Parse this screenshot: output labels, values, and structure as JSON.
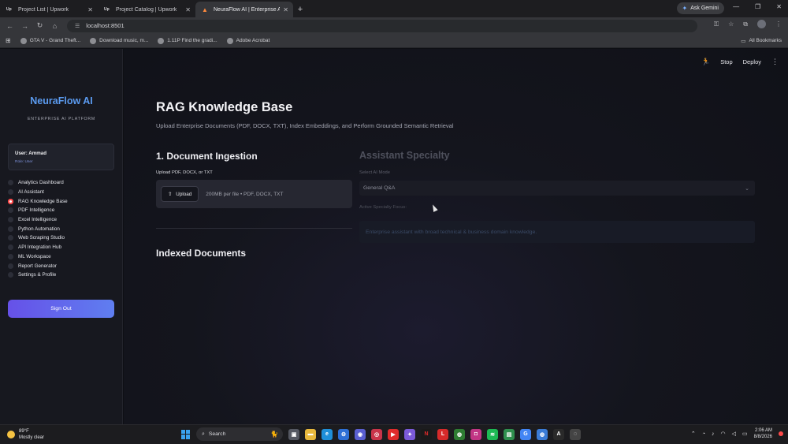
{
  "browser": {
    "tabs": [
      {
        "favicon": "Up",
        "title": "Project List | Upwork",
        "active": false
      },
      {
        "favicon": "Up",
        "title": "Project Catalog | Upwork",
        "active": false
      },
      {
        "favicon": "flame",
        "title": "NeuraFlow AI | Enterprise AI A...",
        "active": true
      }
    ],
    "ask_gemini": "Ask Gemini",
    "url": "localhost:8501",
    "bookmarks": [
      "GTA V - Grand Theft...",
      "Download music, m...",
      "1.11P Find the gradi...",
      "Adobe Acrobat"
    ],
    "all_bookmarks": "All Bookmarks"
  },
  "sidebar": {
    "brand": "NeuraFlow AI",
    "tagline": "ENTERPRISE AI PLATFORM",
    "user_name": "User: Ammad",
    "user_role": "Role: User",
    "nav": [
      {
        "label": "Analytics Dashboard",
        "selected": false
      },
      {
        "label": "AI Assistant",
        "selected": false
      },
      {
        "label": "RAG Knowledge Base",
        "selected": true
      },
      {
        "label": "PDF Intelligence",
        "selected": false
      },
      {
        "label": "Excel Intelligence",
        "selected": false
      },
      {
        "label": "Python Automation",
        "selected": false
      },
      {
        "label": "Web Scraping Studio",
        "selected": false
      },
      {
        "label": "API Integration Hub",
        "selected": false
      },
      {
        "label": "ML Workspace",
        "selected": false
      },
      {
        "label": "Report Generator",
        "selected": false
      },
      {
        "label": "Settings & Profile",
        "selected": false
      }
    ],
    "sign_out": "Sign Out"
  },
  "topbar": {
    "stop": "Stop",
    "deploy": "Deploy"
  },
  "main": {
    "title": "RAG Knowledge Base",
    "subtitle": "Upload Enterprise Documents (PDF, DOCX, TXT), Index Embeddings, and Perform Grounded Semantic Retrieval",
    "ingestion_heading": "1. Document Ingestion",
    "upload_label": "Upload PDF, DOCX, or TXT",
    "upload_button": "Upload",
    "upload_hint": "200MB per file • PDF, DOCX, TXT",
    "indexed_heading": "Indexed Documents",
    "assistant_heading": "Assistant Specialty",
    "mode_label": "Select AI Mode",
    "mode_value": "General Q&A",
    "focus_label": "Active Specialty Focus:",
    "focus_text": "Enterprise assistant with broad technical & business domain knowledge."
  },
  "taskbar": {
    "temperature": "89°F",
    "weather": "Mostly clear",
    "search": "Search",
    "time": "2:06 AM",
    "date": "8/8/2026"
  }
}
